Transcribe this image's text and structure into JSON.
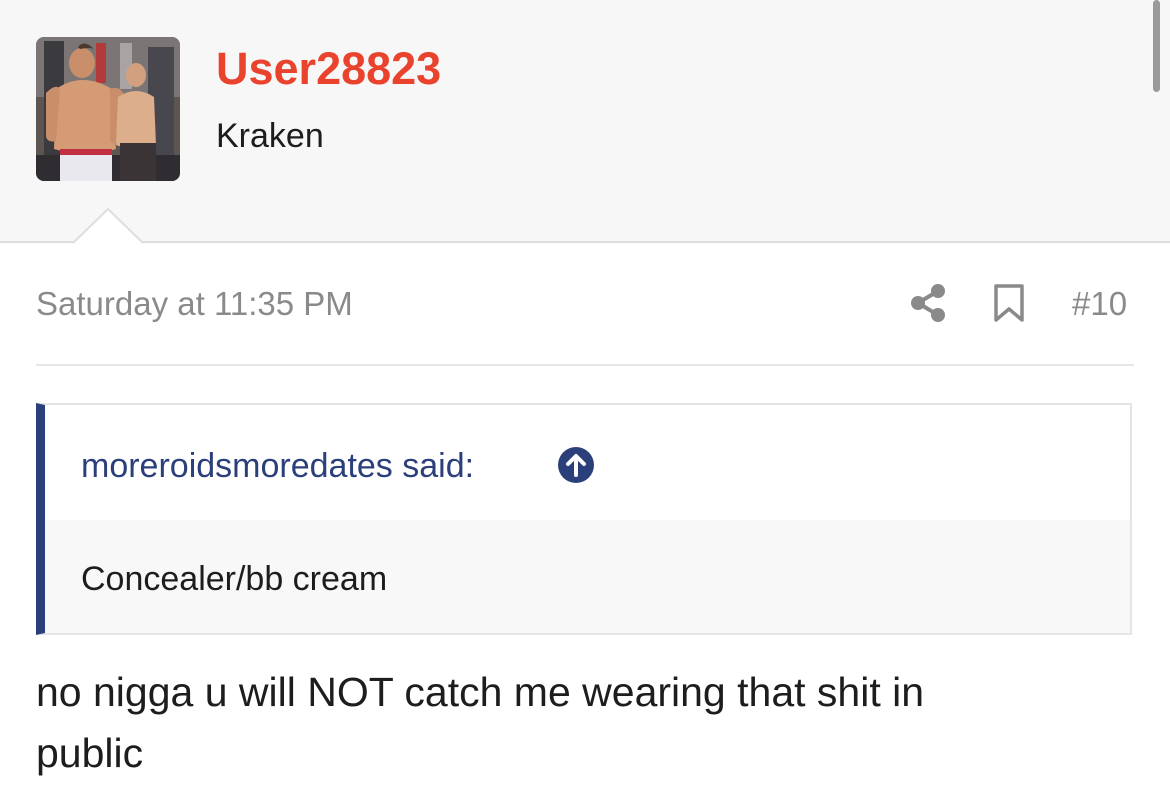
{
  "user": {
    "name": "User28823",
    "title": "Kraken",
    "avatar_icon": "avatar-photo"
  },
  "post": {
    "date": "Saturday at 11:35 PM",
    "number": "#10",
    "share_icon": "share-icon",
    "bookmark_icon": "bookmark-icon"
  },
  "quote": {
    "author_line": "moreroidsmoredates said:",
    "jump_icon": "arrow-up-circle-icon",
    "text": "Concealer/bb cream"
  },
  "message": {
    "text": "no nigga u will NOT catch me wearing that shit in public"
  },
  "colors": {
    "username": "#e9432e",
    "quote_accent": "#2b3f7a",
    "meta_text": "#8a8a8a",
    "header_bg": "#f7f7f7"
  }
}
